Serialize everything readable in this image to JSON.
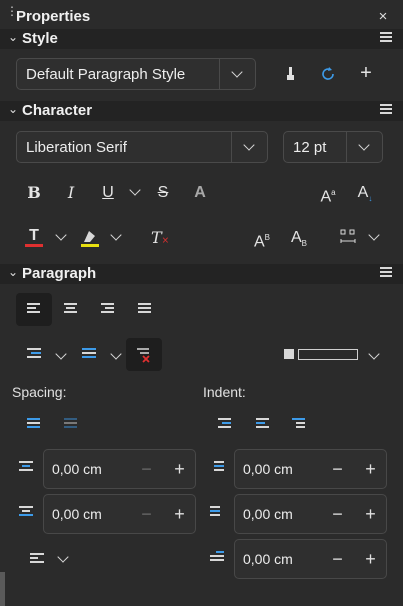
{
  "panel": {
    "title": "Properties",
    "close_glyph": "×"
  },
  "sections": {
    "style": {
      "label": "Style"
    },
    "character": {
      "label": "Character"
    },
    "paragraph": {
      "label": "Paragraph"
    }
  },
  "style": {
    "paragraph_style": "Default Paragraph Style"
  },
  "character": {
    "font_name": "Liberation Serif",
    "font_size": "12 pt",
    "font_color": "#e03030",
    "highlight_color": "#e8e010",
    "buttons": {
      "bold": "B",
      "italic": "I",
      "underline": "U",
      "strikethrough": "S",
      "shadow": "A",
      "superscript": "A",
      "subscript": "A",
      "clear": "T"
    }
  },
  "paragraph": {
    "spacing_label": "Spacing:",
    "indent_label": "Indent:",
    "above_spacing": "0,00 cm",
    "below_spacing": "0,00 cm",
    "before_indent": "0,00 cm",
    "after_indent": "0,00 cm",
    "first_line_indent": "0,00 cm",
    "minus_glyph": "−",
    "plus_glyph": "+"
  },
  "icons": [
    "grip-icon",
    "close-icon",
    "menu-icon",
    "chevron-down-icon",
    "brush-icon",
    "refresh-icon",
    "plus-icon",
    "bold-icon",
    "italic-icon",
    "underline-icon",
    "strikethrough-icon",
    "shadow-icon",
    "superscript-icon",
    "subscript-icon",
    "font-color-icon",
    "highlight-icon",
    "clear-format-icon",
    "char-spacing-icon",
    "align-left-icon",
    "align-center-icon",
    "align-right-icon",
    "justify-icon",
    "bullets-icon",
    "numbering-icon",
    "no-list-icon",
    "background-icon",
    "line-spacing-icon"
  ]
}
